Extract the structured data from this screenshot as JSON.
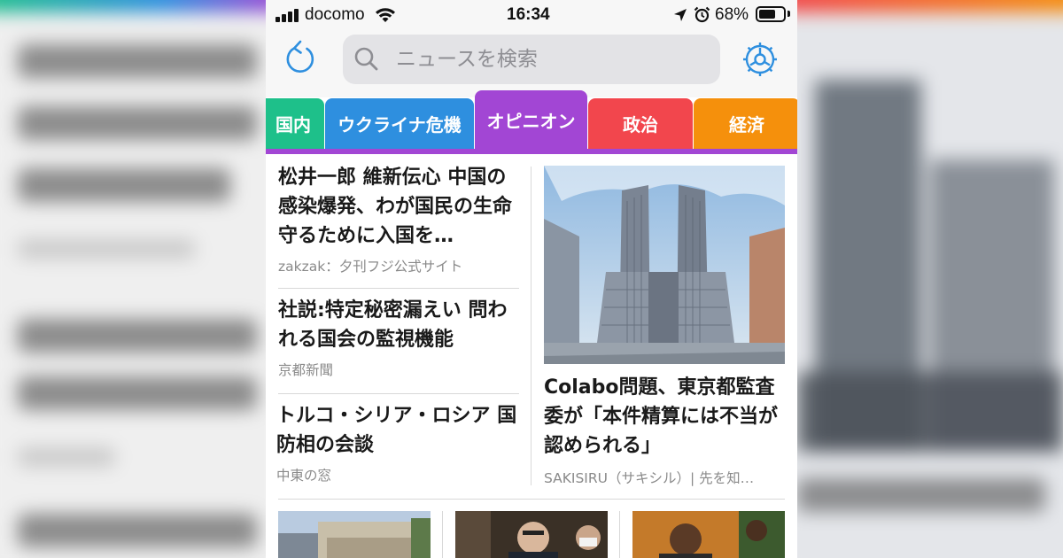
{
  "status_bar": {
    "carrier": "docomo",
    "time": "16:34",
    "battery": "68%",
    "battery_level": 0.68
  },
  "search": {
    "placeholder": "ニュースを検索",
    "value": ""
  },
  "tabs": [
    {
      "label": "国内",
      "color": "#1ec08a",
      "active": false
    },
    {
      "label": "ウクライナ危機",
      "color": "#2e8fdf",
      "active": false
    },
    {
      "label": "オピニオン",
      "color": "#a246d4",
      "active": true
    },
    {
      "label": "政治",
      "color": "#f2464d",
      "active": false
    },
    {
      "label": "経済",
      "color": "#f5900c",
      "active": false
    }
  ],
  "articles": [
    {
      "title": "松井一郎 維新伝心 中国の感染爆発、わが国民の生命守るために入国を…",
      "source": "zakzak：夕刊フジ公式サイト"
    },
    {
      "title": "社説:特定秘密漏えい 問われる国会の監視機能",
      "source": "京都新聞"
    },
    {
      "title": "トルコ・シリア・ロシア 国防相の会談",
      "source": "中東の窓"
    }
  ],
  "feature": {
    "title": "Colabo問題、東京都監査委が「本件精算には不当が認められる」",
    "source": "SAKISIRU（サキシル）| 先を知…"
  },
  "icons": {
    "refresh": "refresh-icon",
    "search": "search-icon",
    "settings": "gear-icon",
    "location": "location-arrow-icon",
    "alarm": "alarm-clock-icon",
    "wifi": "wifi-icon"
  },
  "colors": {
    "accent": "#2e8fdf",
    "active_tab": "#a246d4"
  }
}
